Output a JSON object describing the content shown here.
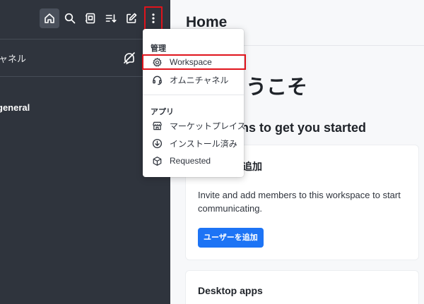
{
  "sidebar": {
    "toolbar": {
      "home": "home-icon",
      "search": "search-icon",
      "directory": "directory-icon",
      "sort": "sort-icon",
      "create_new": "pencil-square-icon",
      "options": "kebab-menu-icon"
    },
    "omnichannel_label": "ャネル",
    "omnichannel_icon": "omnichannel-off-icon",
    "channel_name": "general"
  },
  "main": {
    "title": "Home",
    "welcome": "ようこそ",
    "steps_title": "ns to get you started",
    "card_add_users": {
      "title": "追加",
      "text": "Invite and add members to this workspace to start communicating.",
      "button_label": "ユーザーを追加"
    },
    "card_desktop": {
      "title": "Desktop apps"
    }
  },
  "menu": {
    "section_admin": "管理",
    "workspace": "Workspace",
    "omnichannel": "オムニチャネル",
    "section_apps": "アプリ",
    "marketplace": "マーケットプレイス",
    "installed": "インストール済み",
    "requested": "Requested"
  },
  "colors": {
    "sidebar_bg": "#2f343d",
    "accent_blue": "#1d74f5",
    "highlight_red": "#e0141c"
  }
}
